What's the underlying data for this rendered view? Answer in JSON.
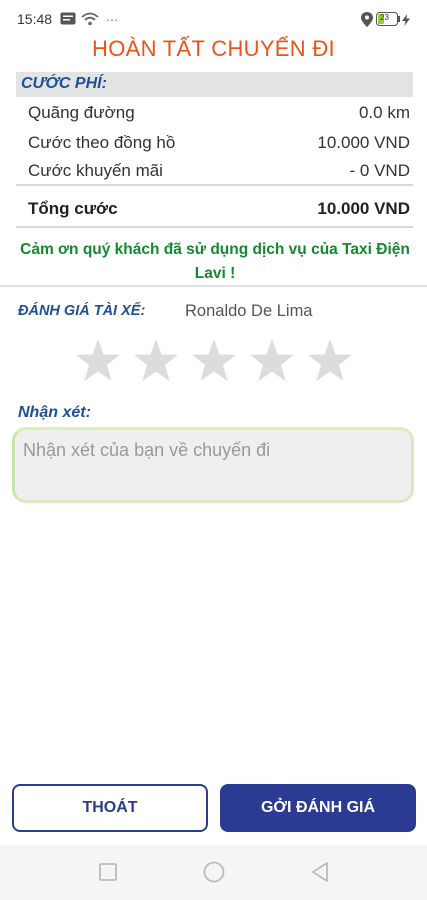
{
  "status_bar": {
    "time": "15:48",
    "battery": "23"
  },
  "screen": {
    "title": "HOÀN TẤT CHUYẾN ĐI"
  },
  "fare": {
    "header": "CƯỚC PHÍ:",
    "rows": [
      {
        "label": "Quãng đường",
        "value": "0.0 km"
      },
      {
        "label": "Cước theo đồng hồ",
        "value": "10.000 VND"
      },
      {
        "label": "Cước khuyến mãi",
        "value": "- 0 VND"
      }
    ],
    "total": {
      "label": "Tổng cước",
      "value": "10.000 VND"
    }
  },
  "thanks_message": "Cảm ơn quý khách đã sử dụng dịch vụ của Taxi Điện Lavi !",
  "rating": {
    "label": "ĐÁNH GIÁ TÀI XẾ:",
    "driver_name": "Ronaldo De Lima",
    "stars_total": 5,
    "stars_selected": 0
  },
  "comment": {
    "label": "Nhận xét:",
    "placeholder": "Nhận xét của bạn về chuyến đi",
    "value": ""
  },
  "buttons": {
    "exit": "THOÁT",
    "submit": "GỞI ĐÁNH GIÁ"
  },
  "colors": {
    "title": "#e8551a",
    "accent_blue": "#2b3b93",
    "header_blue": "#1e4f9a",
    "thanks_green": "#138a2e",
    "star_empty": "#dcdcdc"
  }
}
